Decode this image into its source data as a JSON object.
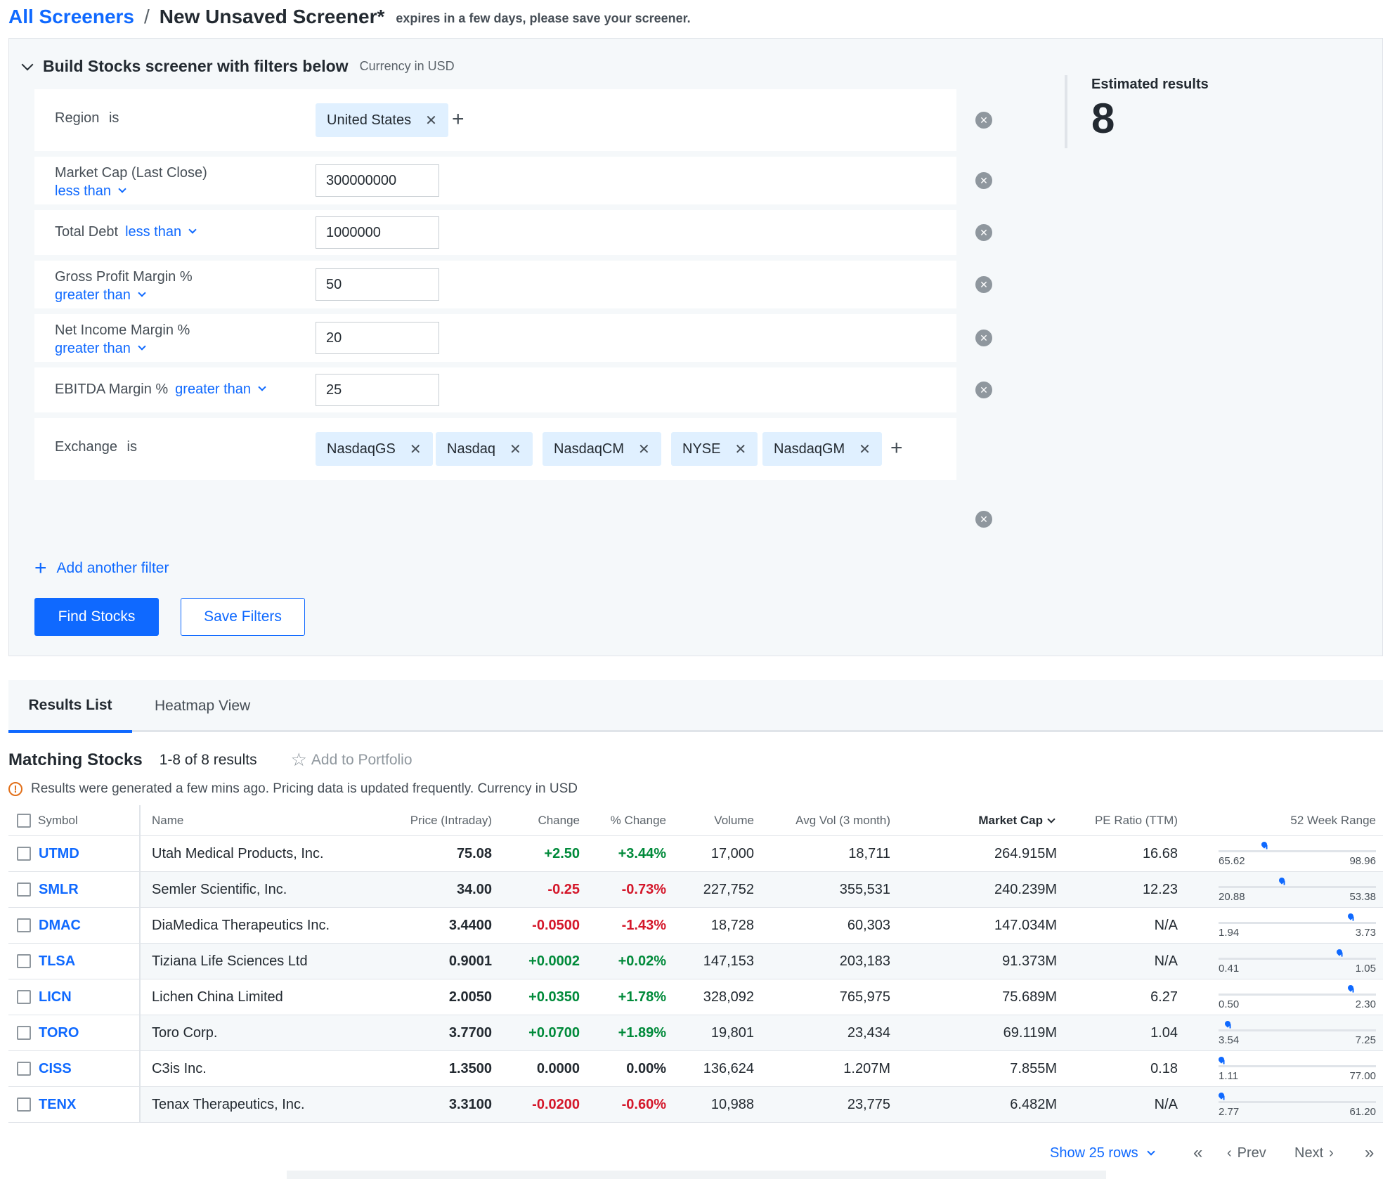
{
  "breadcrumb": {
    "root": "All Screeners",
    "separator": "/",
    "title": "New Unsaved Screener*",
    "note": "expires in a few days, please save your screener."
  },
  "builder": {
    "title": "Build Stocks screener with filters below",
    "currency": "Currency in USD",
    "filters": {
      "region": {
        "label": "Region",
        "op": "is",
        "chips": [
          "United States"
        ]
      },
      "market_cap": {
        "label": "Market Cap (Last Close)",
        "op": "less than",
        "value": "300000000"
      },
      "total_debt": {
        "label": "Total Debt",
        "op": "less than",
        "value": "1000000"
      },
      "gross_margin": {
        "label": "Gross Profit Margin %",
        "op": "greater than",
        "value": "50"
      },
      "net_margin": {
        "label": "Net Income Margin %",
        "op": "greater than",
        "value": "20"
      },
      "ebitda_margin": {
        "label": "EBITDA Margin %",
        "op": "greater than",
        "value": "25"
      },
      "exchange": {
        "label": "Exchange",
        "op": "is",
        "chips": [
          "NasdaqGS",
          "Nasdaq",
          "NasdaqCM",
          "NYSE",
          "NasdaqGM"
        ]
      }
    },
    "add_filter": "Add another filter",
    "find_button": "Find Stocks",
    "save_button": "Save Filters",
    "estimated_label": "Estimated results",
    "estimated_count": "8"
  },
  "tabs": {
    "results": "Results List",
    "heatmap": "Heatmap View"
  },
  "results": {
    "title": "Matching Stocks",
    "count": "1-8 of 8 results",
    "add_portfolio": "Add to Portfolio",
    "notice": "Results were generated a few mins ago. Pricing data is updated frequently. Currency in USD"
  },
  "table": {
    "headers": {
      "symbol": "Symbol",
      "name": "Name",
      "price": "Price (Intraday)",
      "change": "Change",
      "pct": "% Change",
      "volume": "Volume",
      "avgvol": "Avg Vol (3 month)",
      "mcap": "Market Cap",
      "pe": "PE Ratio (TTM)",
      "range": "52 Week Range"
    },
    "rows": [
      {
        "symbol": "UTMD",
        "name": "Utah Medical Products, Inc.",
        "price": "75.08",
        "change": "+2.50",
        "pct": "+3.44%",
        "volume": "17,000",
        "avgvol": "18,711",
        "mcap": "264.915M",
        "pe": "16.68",
        "low": "65.62",
        "high": "98.96",
        "pos": 0.29
      },
      {
        "symbol": "SMLR",
        "name": "Semler Scientific, Inc.",
        "price": "34.00",
        "change": "-0.25",
        "pct": "-0.73%",
        "volume": "227,752",
        "avgvol": "355,531",
        "mcap": "240.239M",
        "pe": "12.23",
        "low": "20.88",
        "high": "53.38",
        "pos": 0.4
      },
      {
        "symbol": "DMAC",
        "name": "DiaMedica Therapeutics Inc.",
        "price": "3.4400",
        "change": "-0.0500",
        "pct": "-1.43%",
        "volume": "18,728",
        "avgvol": "60,303",
        "mcap": "147.034M",
        "pe": "N/A",
        "low": "1.94",
        "high": "3.73",
        "pos": 0.84
      },
      {
        "symbol": "TLSA",
        "name": "Tiziana Life Sciences Ltd",
        "price": "0.9001",
        "change": "+0.0002",
        "pct": "+0.02%",
        "volume": "147,153",
        "avgvol": "203,183",
        "mcap": "91.373M",
        "pe": "N/A",
        "low": "0.41",
        "high": "1.05",
        "pos": 0.77
      },
      {
        "symbol": "LICN",
        "name": "Lichen China Limited",
        "price": "2.0050",
        "change": "+0.0350",
        "pct": "+1.78%",
        "volume": "328,092",
        "avgvol": "765,975",
        "mcap": "75.689M",
        "pe": "6.27",
        "low": "0.50",
        "high": "2.30",
        "pos": 0.84
      },
      {
        "symbol": "TORO",
        "name": "Toro Corp.",
        "price": "3.7700",
        "change": "+0.0700",
        "pct": "+1.89%",
        "volume": "19,801",
        "avgvol": "23,434",
        "mcap": "69.119M",
        "pe": "1.04",
        "low": "3.54",
        "high": "7.25",
        "pos": 0.06
      },
      {
        "symbol": "CISS",
        "name": "C3is Inc.",
        "price": "1.3500",
        "change": "0.0000",
        "pct": "0.00%",
        "volume": "136,624",
        "avgvol": "1.207M",
        "mcap": "7.855M",
        "pe": "0.18",
        "low": "1.11",
        "high": "77.00",
        "pos": 0.003
      },
      {
        "symbol": "TENX",
        "name": "Tenax Therapeutics, Inc.",
        "price": "3.3100",
        "change": "-0.0200",
        "pct": "-0.60%",
        "volume": "10,988",
        "avgvol": "23,775",
        "mcap": "6.482M",
        "pe": "N/A",
        "low": "2.77",
        "high": "61.20",
        "pos": 0.009
      }
    ]
  },
  "footer": {
    "rows_label": "Show 25 rows",
    "prev": "Prev",
    "next": "Next"
  }
}
